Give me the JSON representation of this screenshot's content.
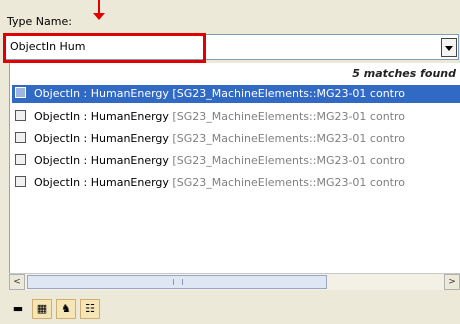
{
  "type_name_label": "Type Name:",
  "search": {
    "value": "ObjectIn Hum"
  },
  "results": {
    "match_count": "5 matches found",
    "items": [
      {
        "name": "ObjectIn : HumanEnergy",
        "namespace": "[SG23_MachineElements::MG23-01 contro",
        "selected": true
      },
      {
        "name": "ObjectIn : HumanEnergy",
        "namespace": "[SG23_MachineElements::MG23-01 contro",
        "selected": false
      },
      {
        "name": "ObjectIn : HumanEnergy",
        "namespace": "[SG23_MachineElements::MG23-01 contro",
        "selected": false
      },
      {
        "name": "ObjectIn : HumanEnergy",
        "namespace": "[SG23_MachineElements::MG23-01 contro",
        "selected": false
      },
      {
        "name": "ObjectIn : HumanEnergy",
        "namespace": "[SG23_MachineElements::MG23-01 contro",
        "selected": false
      }
    ]
  },
  "scrollbar": {
    "left_arrow": "<",
    "right_arrow": ">",
    "thumb_grip": "|||"
  },
  "toolbar": {
    "buttons": [
      {
        "icon": "save-icon",
        "glyph": "▬"
      },
      {
        "icon": "find-in-model-icon",
        "glyph": "▦"
      },
      {
        "icon": "filter-icon",
        "glyph": "♞"
      },
      {
        "icon": "options-icon",
        "glyph": "☷"
      }
    ]
  },
  "colors": {
    "selection": "#316ac5",
    "highlight_annotation": "#e00000",
    "namespace_text": "#808080"
  }
}
